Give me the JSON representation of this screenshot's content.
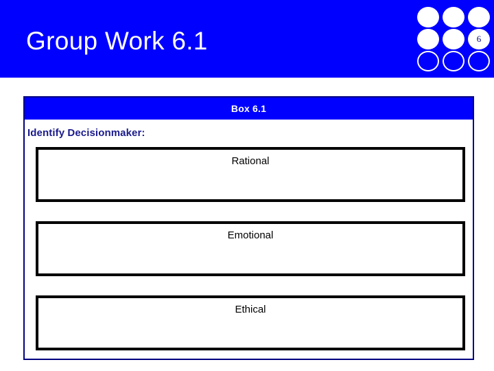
{
  "slide": {
    "title": "Group Work 6.1",
    "banner_color": "#0000ff",
    "title_color": "#ffffff"
  },
  "dot_grid": {
    "badge_number": "6",
    "dots": [
      {
        "style": "filled",
        "label": ""
      },
      {
        "style": "filled",
        "label": ""
      },
      {
        "style": "filled",
        "label": ""
      },
      {
        "style": "filled",
        "label": ""
      },
      {
        "style": "filled",
        "label": ""
      },
      {
        "style": "filled",
        "label": "6"
      },
      {
        "style": "hollow",
        "label": ""
      },
      {
        "style": "hollow",
        "label": ""
      },
      {
        "style": "hollow",
        "label": ""
      }
    ]
  },
  "content_box": {
    "header_title": "Box 6.1",
    "header_color": "#0000ff",
    "border_color": "#000080",
    "prompt_label": "Identify Decisionmaker:",
    "prompt_color": "#1a1a8c",
    "responses": [
      {
        "label": "Rational",
        "value": ""
      },
      {
        "label": "Emotional",
        "value": ""
      },
      {
        "label": "Ethical",
        "value": ""
      }
    ]
  }
}
